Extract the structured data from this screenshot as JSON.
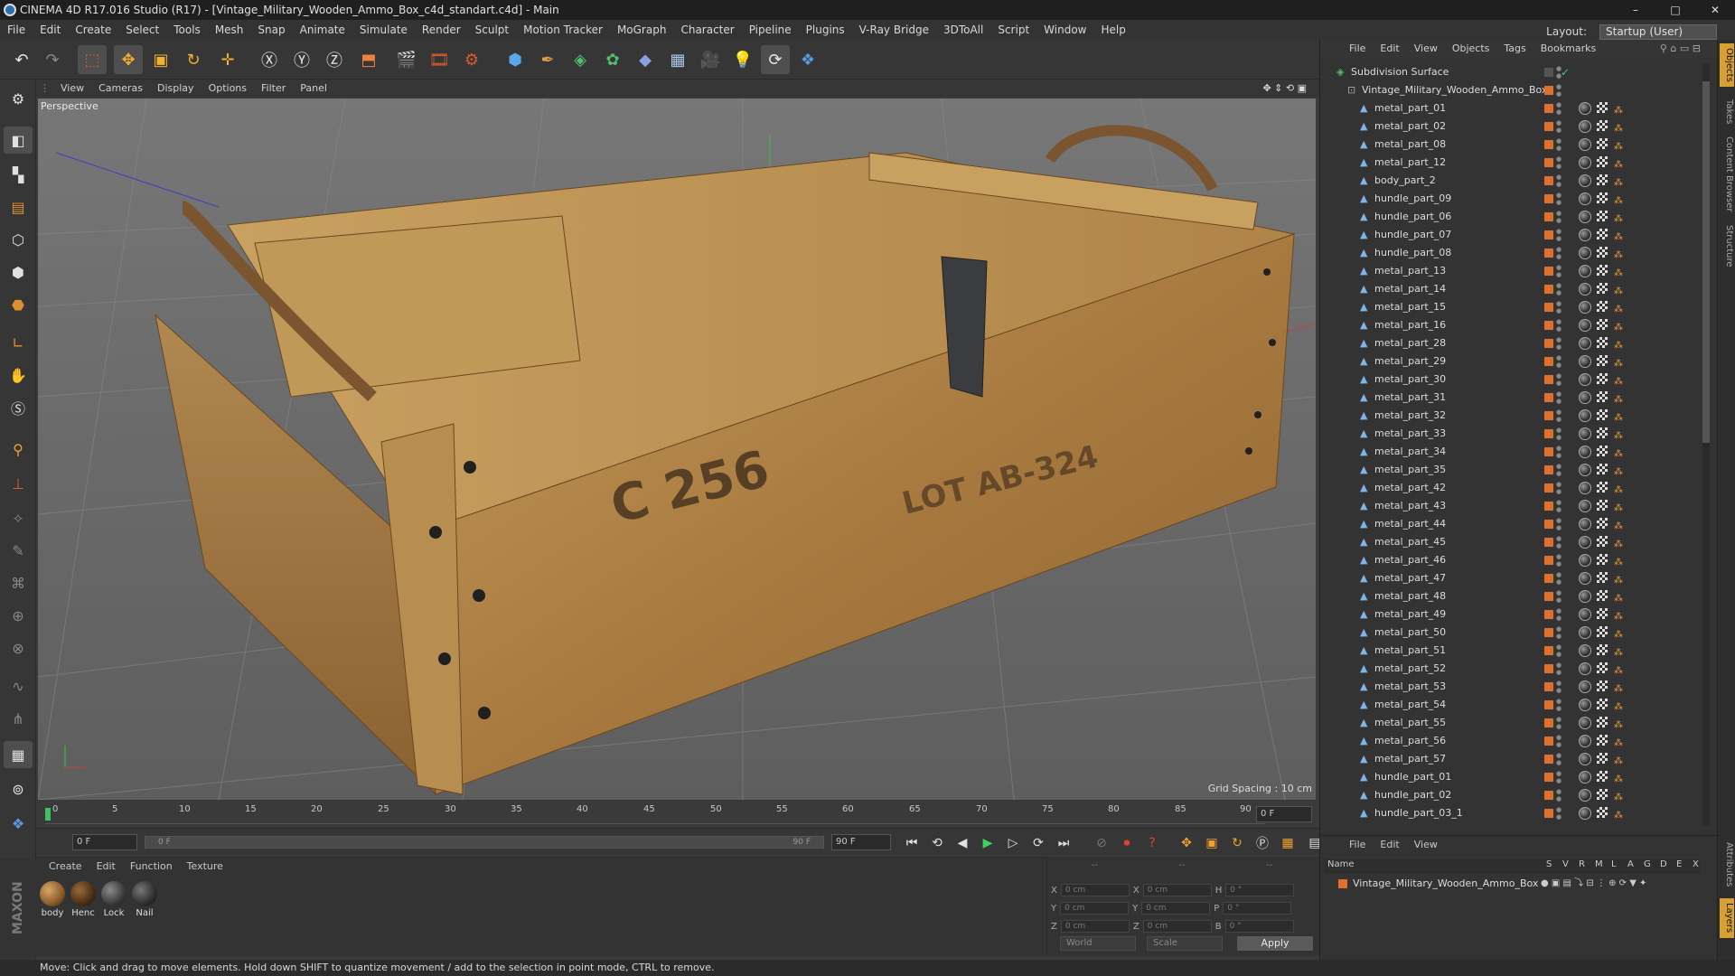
{
  "window": {
    "title": "CINEMA 4D R17.016 Studio (R17) - [Vintage_Military_Wooden_Ammo_Box_c4d_standart.c4d] - Main",
    "controls": [
      "–",
      "□",
      "✕"
    ]
  },
  "menubar": {
    "items": [
      "File",
      "Edit",
      "Create",
      "Select",
      "Tools",
      "Mesh",
      "Snap",
      "Animate",
      "Simulate",
      "Render",
      "Sculpt",
      "Motion Tracker",
      "MoGraph",
      "Character",
      "Pipeline",
      "Plugins",
      "V-Ray Bridge",
      "3DToAll",
      "Script",
      "Window",
      "Help"
    ],
    "layout_label": "Layout:",
    "layout_value": "Startup (User)"
  },
  "viewport": {
    "menu": [
      "View",
      "Cameras",
      "Display",
      "Options",
      "Filter",
      "Panel"
    ],
    "label": "Perspective",
    "grid_spacing": "Grid Spacing : 10 cm",
    "stencil_lines": [
      "C 256",
      "LOT AB-324"
    ]
  },
  "timeline": {
    "ticks": [
      "0",
      "5",
      "10",
      "15",
      "20",
      "25",
      "30",
      "35",
      "40",
      "45",
      "50",
      "55",
      "60",
      "65",
      "70",
      "75",
      "80",
      "85",
      "90"
    ],
    "frame_end_field": "0 F",
    "start_field": "0 F",
    "range_start": "0 F",
    "range_end": "90 F",
    "end_field": "90 F"
  },
  "materials": {
    "menu": [
      "Create",
      "Edit",
      "Function",
      "Texture"
    ],
    "items": [
      {
        "name": "body",
        "color": "#8a5a2a"
      },
      {
        "name": "Henc",
        "color": "#4a2e18"
      },
      {
        "name": "Lock",
        "color": "#3a3a3a"
      },
      {
        "name": "Nail",
        "color": "#2e2e2e"
      }
    ]
  },
  "coords": {
    "headers": [
      "--",
      "--",
      "--"
    ],
    "rows": [
      {
        "a": "X",
        "v1": "0 cm",
        "b": "X",
        "v2": "0 cm",
        "c": "H",
        "v3": "0 °"
      },
      {
        "a": "Y",
        "v1": "0 cm",
        "b": "Y",
        "v2": "0 cm",
        "c": "P",
        "v3": "0 °"
      },
      {
        "a": "Z",
        "v1": "0 cm",
        "b": "Z",
        "v2": "0 cm",
        "c": "B",
        "v3": "0 °"
      }
    ],
    "space": "World",
    "mode": "Scale",
    "apply": "Apply"
  },
  "objects": {
    "menu": [
      "File",
      "Edit",
      "View",
      "Objects",
      "Tags",
      "Bookmarks"
    ],
    "root": "Subdivision Surface",
    "group": "Vintage_Military_Wooden_Ammo_Box",
    "items": [
      "metal_part_01",
      "metal_part_02",
      "metal_part_08",
      "metal_part_12",
      "body_part_2",
      "hundle_part_09",
      "hundle_part_06",
      "hundle_part_07",
      "hundle_part_08",
      "metal_part_13",
      "metal_part_14",
      "metal_part_15",
      "metal_part_16",
      "metal_part_28",
      "metal_part_29",
      "metal_part_30",
      "metal_part_31",
      "metal_part_32",
      "metal_part_33",
      "metal_part_34",
      "metal_part_35",
      "metal_part_42",
      "metal_part_43",
      "metal_part_44",
      "metal_part_45",
      "metal_part_46",
      "metal_part_47",
      "metal_part_48",
      "metal_part_49",
      "metal_part_50",
      "metal_part_51",
      "metal_part_52",
      "metal_part_53",
      "metal_part_54",
      "metal_part_55",
      "metal_part_56",
      "metal_part_57",
      "hundle_part_01",
      "hundle_part_02",
      "hundle_part_03_1"
    ]
  },
  "layers": {
    "menu": [
      "File",
      "Edit",
      "View"
    ],
    "header_name": "Name",
    "header_cols": [
      "S",
      "V",
      "R",
      "M",
      "L",
      "A",
      "G",
      "D",
      "E",
      "X"
    ],
    "row": "Vintage_Military_Wooden_Ammo_Box"
  },
  "side_tabs": [
    "Objects",
    "Takes",
    "Content Browser",
    "Structure",
    "Attributes",
    "Layers"
  ],
  "status": "Move: Click and drag to move elements. Hold down SHIFT to quantize movement / add to the selection in point mode, CTRL to remove.",
  "brand": "MAXON CINEMA 4D"
}
